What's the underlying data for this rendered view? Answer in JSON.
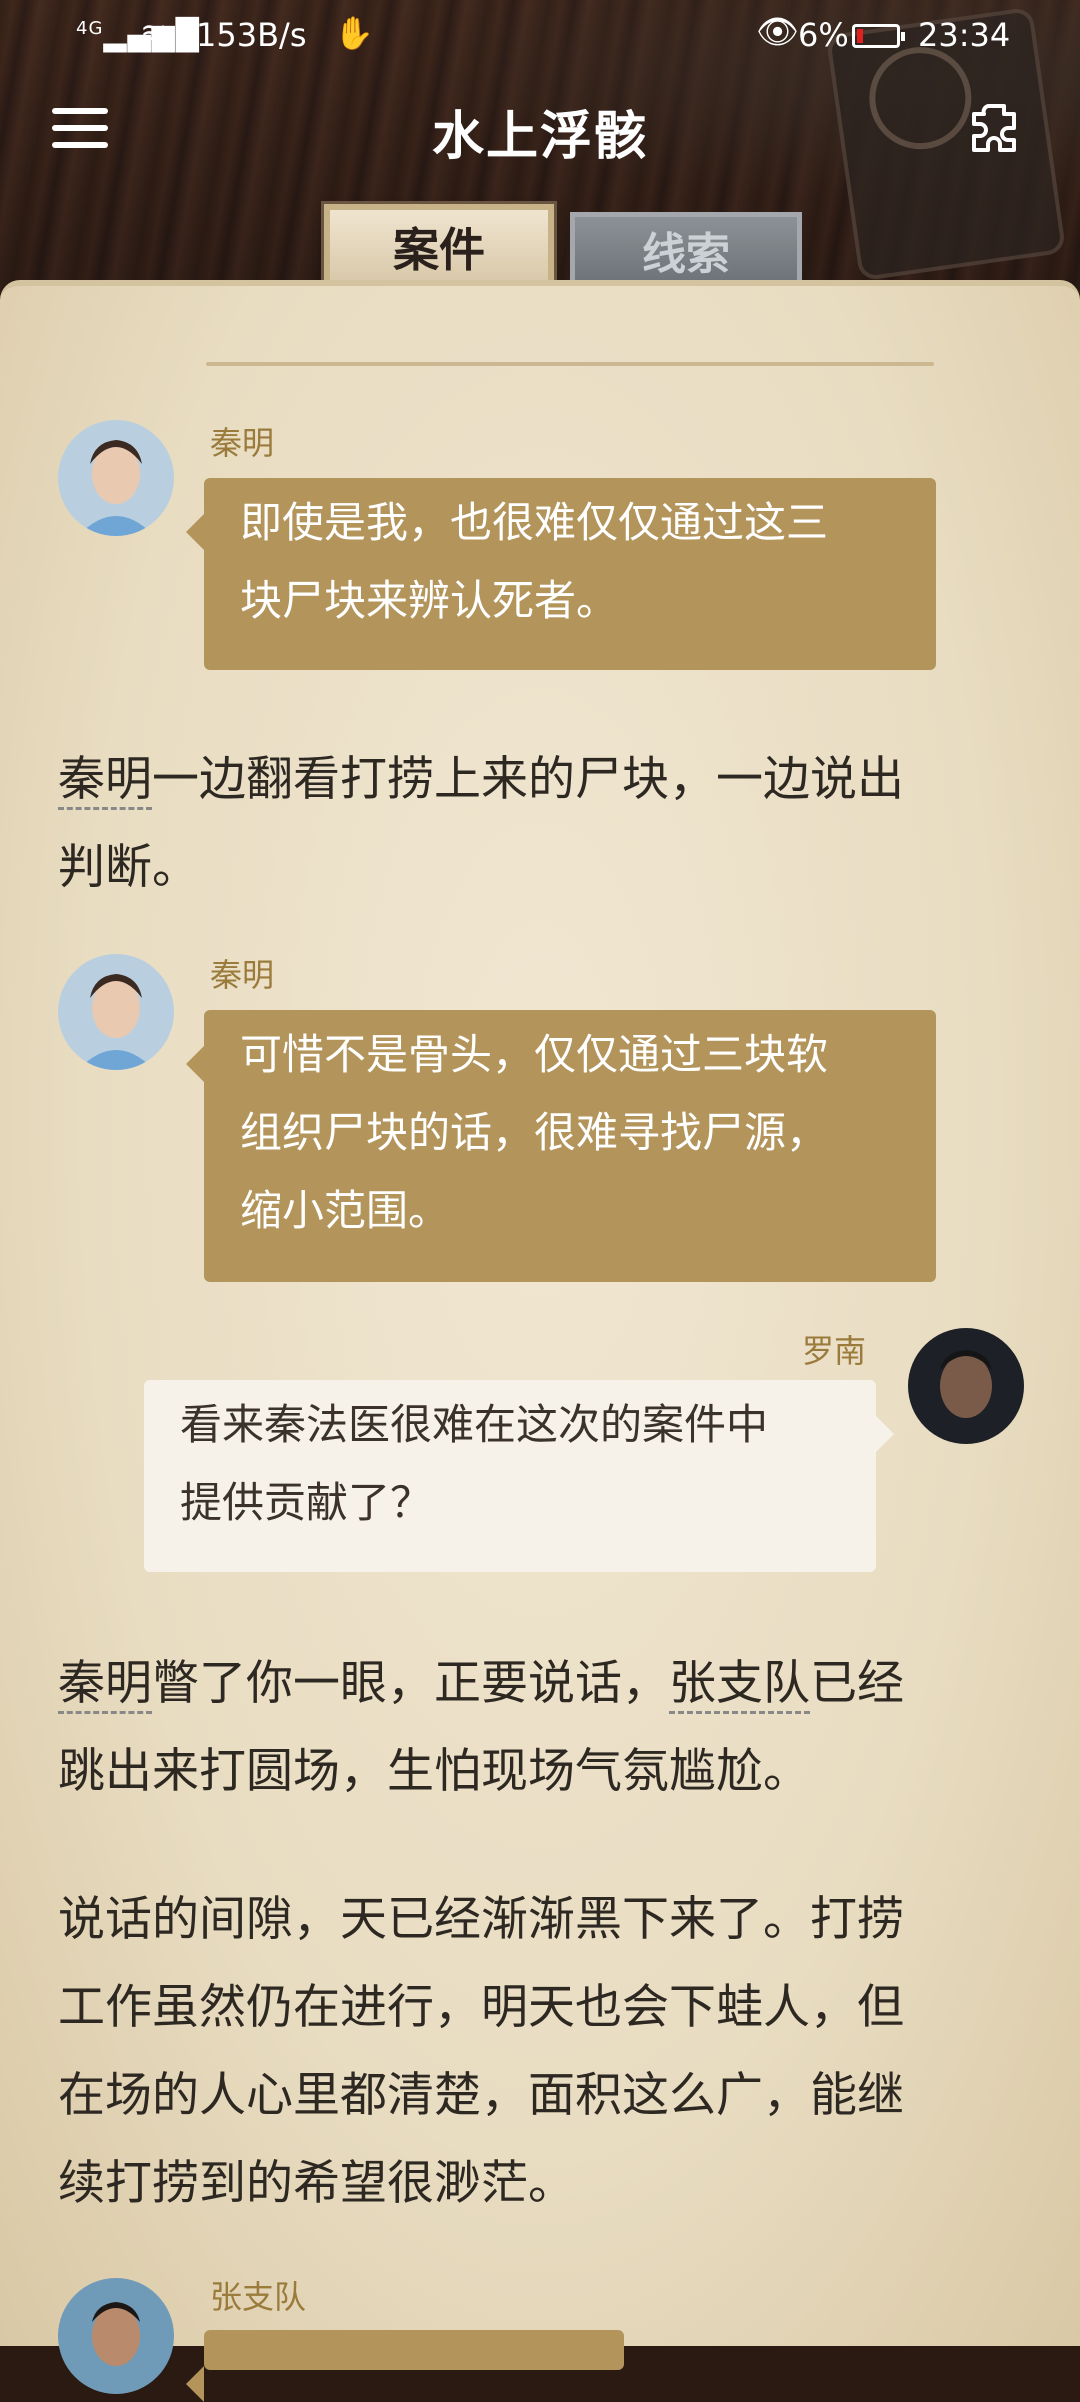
{
  "status_bar": {
    "signal": "4G",
    "speed": "153B/s",
    "battery": "6%",
    "time": "23:34",
    "icons": [
      "signal-icon",
      "wifi-icon",
      "hand-icon",
      "eye-icon",
      "battery-icon"
    ]
  },
  "header": {
    "title": "水上浮骸",
    "menu_icon": "menu-icon",
    "settings_icon": "puzzle-gear-icon"
  },
  "tabs": [
    {
      "label": "案件",
      "active": true
    },
    {
      "label": "线索",
      "active": false
    }
  ],
  "story": {
    "msg1": {
      "speaker": "秦明",
      "line1": "即使是我，也很难仅仅通过这三",
      "line2": "块尸块来辨认死者。"
    },
    "narr1": {
      "name": "秦明",
      "rest": "一边翻看打捞上来的尸块，一边说出",
      "line2": "判断。"
    },
    "msg2": {
      "speaker": "秦明",
      "line1": "可惜不是骨头，仅仅通过三块软",
      "line2": "组织尸块的话，很难寻找尸源，",
      "line3": "缩小范围。"
    },
    "msg3": {
      "speaker": "罗南",
      "line1": "看来秦法医很难在这次的案件中",
      "line2": "提供贡献了？"
    },
    "narr2": {
      "name1": "秦明",
      "mid": "瞥了你一眼，正要说话，",
      "name2": "张支队",
      "end": "已经",
      "line2": "跳出来打圆场，生怕现场气氛尴尬。"
    },
    "narr3": {
      "line1": "说话的间隙，天已经渐渐黑下来了。打捞",
      "line2": "工作虽然仍在进行，明天也会下蛙人，但",
      "line3": "在场的人心里都清楚，面积这么广，能继",
      "line4": "续打捞到的希望很渺茫。"
    },
    "msg4": {
      "speaker": "张支队"
    }
  },
  "colors": {
    "bubble_left": "#b3955c",
    "bubble_right": "#f6f2ea",
    "speaker_name": "#9a7b3c",
    "paper": "#ecdfc4"
  }
}
